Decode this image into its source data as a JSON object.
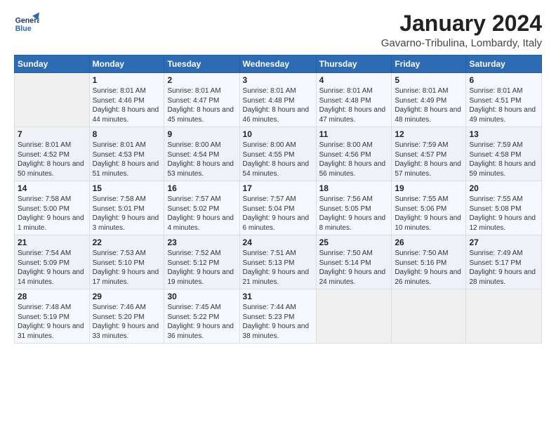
{
  "header": {
    "logo_line1": "General",
    "logo_line2": "Blue",
    "month_title": "January 2024",
    "location": "Gavarno-Tribulina, Lombardy, Italy"
  },
  "weekdays": [
    "Sunday",
    "Monday",
    "Tuesday",
    "Wednesday",
    "Thursday",
    "Friday",
    "Saturday"
  ],
  "weeks": [
    [
      {
        "day": "",
        "sunrise": "",
        "sunset": "",
        "daylight": ""
      },
      {
        "day": "1",
        "sunrise": "Sunrise: 8:01 AM",
        "sunset": "Sunset: 4:46 PM",
        "daylight": "Daylight: 8 hours and 44 minutes."
      },
      {
        "day": "2",
        "sunrise": "Sunrise: 8:01 AM",
        "sunset": "Sunset: 4:47 PM",
        "daylight": "Daylight: 8 hours and 45 minutes."
      },
      {
        "day": "3",
        "sunrise": "Sunrise: 8:01 AM",
        "sunset": "Sunset: 4:48 PM",
        "daylight": "Daylight: 8 hours and 46 minutes."
      },
      {
        "day": "4",
        "sunrise": "Sunrise: 8:01 AM",
        "sunset": "Sunset: 4:48 PM",
        "daylight": "Daylight: 8 hours and 47 minutes."
      },
      {
        "day": "5",
        "sunrise": "Sunrise: 8:01 AM",
        "sunset": "Sunset: 4:49 PM",
        "daylight": "Daylight: 8 hours and 48 minutes."
      },
      {
        "day": "6",
        "sunrise": "Sunrise: 8:01 AM",
        "sunset": "Sunset: 4:51 PM",
        "daylight": "Daylight: 8 hours and 49 minutes."
      }
    ],
    [
      {
        "day": "7",
        "sunrise": "Sunrise: 8:01 AM",
        "sunset": "Sunset: 4:52 PM",
        "daylight": "Daylight: 8 hours and 50 minutes."
      },
      {
        "day": "8",
        "sunrise": "Sunrise: 8:01 AM",
        "sunset": "Sunset: 4:53 PM",
        "daylight": "Daylight: 8 hours and 51 minutes."
      },
      {
        "day": "9",
        "sunrise": "Sunrise: 8:00 AM",
        "sunset": "Sunset: 4:54 PM",
        "daylight": "Daylight: 8 hours and 53 minutes."
      },
      {
        "day": "10",
        "sunrise": "Sunrise: 8:00 AM",
        "sunset": "Sunset: 4:55 PM",
        "daylight": "Daylight: 8 hours and 54 minutes."
      },
      {
        "day": "11",
        "sunrise": "Sunrise: 8:00 AM",
        "sunset": "Sunset: 4:56 PM",
        "daylight": "Daylight: 8 hours and 56 minutes."
      },
      {
        "day": "12",
        "sunrise": "Sunrise: 7:59 AM",
        "sunset": "Sunset: 4:57 PM",
        "daylight": "Daylight: 8 hours and 57 minutes."
      },
      {
        "day": "13",
        "sunrise": "Sunrise: 7:59 AM",
        "sunset": "Sunset: 4:58 PM",
        "daylight": "Daylight: 8 hours and 59 minutes."
      }
    ],
    [
      {
        "day": "14",
        "sunrise": "Sunrise: 7:58 AM",
        "sunset": "Sunset: 5:00 PM",
        "daylight": "Daylight: 9 hours and 1 minute."
      },
      {
        "day": "15",
        "sunrise": "Sunrise: 7:58 AM",
        "sunset": "Sunset: 5:01 PM",
        "daylight": "Daylight: 9 hours and 3 minutes."
      },
      {
        "day": "16",
        "sunrise": "Sunrise: 7:57 AM",
        "sunset": "Sunset: 5:02 PM",
        "daylight": "Daylight: 9 hours and 4 minutes."
      },
      {
        "day": "17",
        "sunrise": "Sunrise: 7:57 AM",
        "sunset": "Sunset: 5:04 PM",
        "daylight": "Daylight: 9 hours and 6 minutes."
      },
      {
        "day": "18",
        "sunrise": "Sunrise: 7:56 AM",
        "sunset": "Sunset: 5:05 PM",
        "daylight": "Daylight: 9 hours and 8 minutes."
      },
      {
        "day": "19",
        "sunrise": "Sunrise: 7:55 AM",
        "sunset": "Sunset: 5:06 PM",
        "daylight": "Daylight: 9 hours and 10 minutes."
      },
      {
        "day": "20",
        "sunrise": "Sunrise: 7:55 AM",
        "sunset": "Sunset: 5:08 PM",
        "daylight": "Daylight: 9 hours and 12 minutes."
      }
    ],
    [
      {
        "day": "21",
        "sunrise": "Sunrise: 7:54 AM",
        "sunset": "Sunset: 5:09 PM",
        "daylight": "Daylight: 9 hours and 14 minutes."
      },
      {
        "day": "22",
        "sunrise": "Sunrise: 7:53 AM",
        "sunset": "Sunset: 5:10 PM",
        "daylight": "Daylight: 9 hours and 17 minutes."
      },
      {
        "day": "23",
        "sunrise": "Sunrise: 7:52 AM",
        "sunset": "Sunset: 5:12 PM",
        "daylight": "Daylight: 9 hours and 19 minutes."
      },
      {
        "day": "24",
        "sunrise": "Sunrise: 7:51 AM",
        "sunset": "Sunset: 5:13 PM",
        "daylight": "Daylight: 9 hours and 21 minutes."
      },
      {
        "day": "25",
        "sunrise": "Sunrise: 7:50 AM",
        "sunset": "Sunset: 5:14 PM",
        "daylight": "Daylight: 9 hours and 24 minutes."
      },
      {
        "day": "26",
        "sunrise": "Sunrise: 7:50 AM",
        "sunset": "Sunset: 5:16 PM",
        "daylight": "Daylight: 9 hours and 26 minutes."
      },
      {
        "day": "27",
        "sunrise": "Sunrise: 7:49 AM",
        "sunset": "Sunset: 5:17 PM",
        "daylight": "Daylight: 9 hours and 28 minutes."
      }
    ],
    [
      {
        "day": "28",
        "sunrise": "Sunrise: 7:48 AM",
        "sunset": "Sunset: 5:19 PM",
        "daylight": "Daylight: 9 hours and 31 minutes."
      },
      {
        "day": "29",
        "sunrise": "Sunrise: 7:46 AM",
        "sunset": "Sunset: 5:20 PM",
        "daylight": "Daylight: 9 hours and 33 minutes."
      },
      {
        "day": "30",
        "sunrise": "Sunrise: 7:45 AM",
        "sunset": "Sunset: 5:22 PM",
        "daylight": "Daylight: 9 hours and 36 minutes."
      },
      {
        "day": "31",
        "sunrise": "Sunrise: 7:44 AM",
        "sunset": "Sunset: 5:23 PM",
        "daylight": "Daylight: 9 hours and 38 minutes."
      },
      {
        "day": "",
        "sunrise": "",
        "sunset": "",
        "daylight": ""
      },
      {
        "day": "",
        "sunrise": "",
        "sunset": "",
        "daylight": ""
      },
      {
        "day": "",
        "sunrise": "",
        "sunset": "",
        "daylight": ""
      }
    ]
  ]
}
